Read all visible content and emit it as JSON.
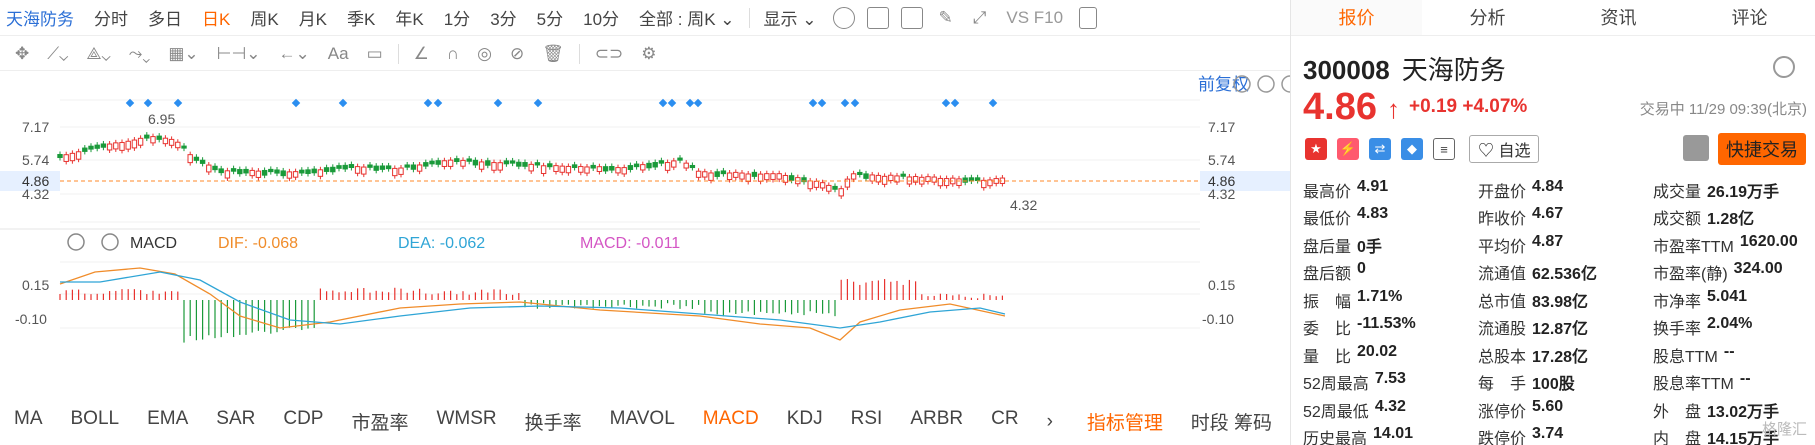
{
  "toolbar": {
    "title": "天海防务",
    "periods": [
      "分时",
      "多日",
      "日K",
      "周K",
      "月K",
      "季K",
      "年K",
      "1分",
      "3分",
      "5分",
      "10分"
    ],
    "active_period": "日K",
    "range": "全部 : 周K",
    "display": "显示",
    "vs": "VS F10"
  },
  "chart": {
    "adjust_label": "前复权",
    "price_labels": [
      "7.17",
      "5.74",
      "4.86",
      "4.32"
    ],
    "max_label": "6.95",
    "min_label": "4.32",
    "current": "4.86",
    "colors": {
      "up": "#e8332f",
      "down": "#1a9a3a",
      "dif": "#f08c2a",
      "dea": "#2fa5d6"
    }
  },
  "macd": {
    "name": "MACD",
    "dif_label": "DIF: ",
    "dif_value": "-0.068",
    "dea_label": "DEA: ",
    "dea_value": "-0.062",
    "macd_label": "MACD: ",
    "macd_value": "-0.011",
    "axis_labels": [
      "0.15",
      "-0.10"
    ]
  },
  "indicators": [
    "MA",
    "BOLL",
    "EMA",
    "SAR",
    "CDP",
    "市盈率",
    "WMSR",
    "换手率",
    "MAVOL",
    "MACD",
    "KDJ",
    "RSI",
    "ARBR",
    "CR"
  ],
  "active_indicator": "MACD",
  "indicator_manager": "指标管理",
  "bottom_right": "时段 筹码",
  "panel": {
    "tabs": [
      "报价",
      "分析",
      "资讯",
      "评论"
    ],
    "code": "300008",
    "name": "天海防务",
    "price": "4.86",
    "change": "+0.19",
    "change_pct": "+4.07%",
    "status": "交易中 11/29 09:39(北京)",
    "fav": "自选",
    "trade": "快捷交易",
    "quote_rows": [
      [
        [
          "最高价",
          "4.91",
          "red"
        ],
        [
          "开盘价",
          "4.84",
          "red"
        ],
        [
          "成交量",
          "26.19万手",
          ""
        ]
      ],
      [
        [
          "最低价",
          "4.83",
          "red"
        ],
        [
          "昨收价",
          "4.67",
          ""
        ],
        [
          "成交额",
          "1.28亿",
          ""
        ]
      ],
      [
        [
          "盘后量",
          "0手",
          ""
        ],
        [
          "平均价",
          "4.87",
          "red"
        ],
        [
          "市盈率TTM",
          "1620.00",
          ""
        ]
      ],
      [
        [
          "盘后额",
          "0",
          ""
        ],
        [
          "流通值",
          "62.536亿",
          ""
        ],
        [
          "市盈率(静)",
          "324.00",
          ""
        ]
      ],
      [
        [
          "振　幅",
          "1.71%",
          ""
        ],
        [
          "总市值",
          "83.98亿",
          ""
        ],
        [
          "市净率",
          "5.041",
          ""
        ]
      ],
      [
        [
          "委　比",
          "-11.53%",
          ""
        ],
        [
          "流通股",
          "12.87亿",
          ""
        ],
        [
          "换手率",
          "2.04%",
          ""
        ]
      ],
      [
        [
          "量　比",
          "20.02",
          ""
        ],
        [
          "总股本",
          "17.28亿",
          ""
        ],
        [
          "股息TTM",
          "--",
          ""
        ]
      ],
      [
        [
          "52周最高",
          "7.53",
          "red"
        ],
        [
          "每　手",
          "100股",
          ""
        ],
        [
          "股息率TTM",
          "--",
          ""
        ]
      ],
      [
        [
          "52周最低",
          "4.32",
          "green"
        ],
        [
          "涨停价",
          "5.60",
          "red"
        ],
        [
          "外　盘",
          "13.02万手",
          "red"
        ]
      ],
      [
        [
          "历史最高",
          "14.01",
          "red"
        ],
        [
          "跌停价",
          "3.74",
          "green"
        ],
        [
          "内　盘",
          "14.15万手",
          "green"
        ]
      ]
    ],
    "watermark": "格隆汇"
  }
}
